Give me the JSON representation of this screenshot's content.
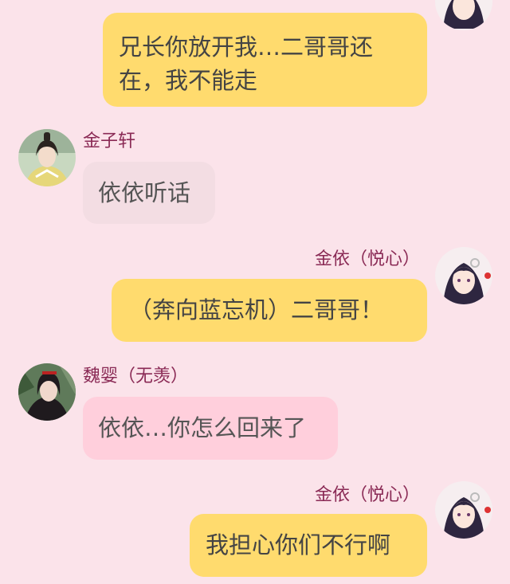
{
  "colors": {
    "background": "#fbe3ea",
    "name_text": "#8a2a55",
    "bubble_self": "#ffdb6e",
    "bubble_jin_zixuan": "#f3dde3",
    "bubble_wei_ying": "#ffcfdc"
  },
  "messages": [
    {
      "side": "right",
      "sender": "",
      "avatar": "jin-yi-avatar",
      "text": "兄长你放开我…二哥哥还在，我不能走"
    },
    {
      "side": "left",
      "sender": "金子轩",
      "avatar": "jin-zixuan-avatar",
      "text": "依依听话"
    },
    {
      "side": "right",
      "sender": "金依（悦心）",
      "avatar": "jin-yi-avatar",
      "text": "（奔向蓝忘机）二哥哥！"
    },
    {
      "side": "left",
      "sender": "魏婴（无羡）",
      "avatar": "wei-ying-avatar",
      "text": "依依…你怎么回来了"
    },
    {
      "side": "right",
      "sender": "金依（悦心）",
      "avatar": "jin-yi-avatar",
      "text": "我担心你们不行啊"
    }
  ]
}
